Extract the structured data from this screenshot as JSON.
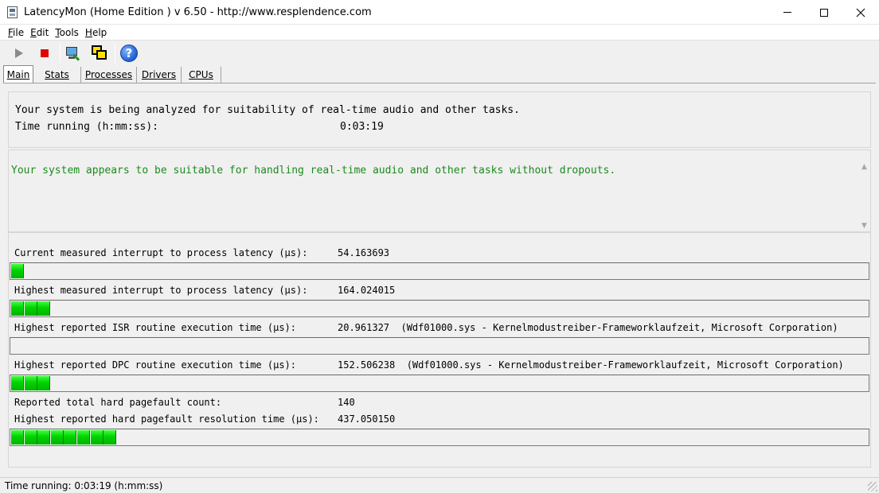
{
  "window": {
    "title": "LatencyMon  (Home Edition )  v 6.50 - http://www.resplendence.com"
  },
  "menu": {
    "items": [
      {
        "key": "F",
        "rest": "ile"
      },
      {
        "key": "E",
        "rest": "dit"
      },
      {
        "key": "T",
        "rest": "ools"
      },
      {
        "key": "H",
        "rest": "elp"
      }
    ]
  },
  "toolbar": {
    "icons": [
      "play-icon",
      "stop-icon",
      "kernel-monitor-icon",
      "windows-icon",
      "help-icon"
    ]
  },
  "tabs": [
    {
      "label": "Main",
      "active": true
    },
    {
      "label": "Stats",
      "active": false
    },
    {
      "label": "Processes",
      "active": false
    },
    {
      "label": "Drivers",
      "active": false
    },
    {
      "label": "CPUs",
      "active": false
    }
  ],
  "analysis": {
    "line1": "Your system is being analyzed for suitability of real-time audio and other tasks.",
    "time_label": "Time running (h:mm:ss):",
    "time_value": "0:03:19"
  },
  "verdict": {
    "text": "Your system appears to be suitable for handling real-time audio and other tasks without dropouts.",
    "color": "#1a8c1a"
  },
  "metrics": {
    "current_latency": {
      "label": "Current measured interrupt to process latency (µs):",
      "value": "54.163693",
      "meter_segments": 1
    },
    "highest_latency": {
      "label": "Highest measured interrupt to process latency (µs):",
      "value": "164.024015",
      "meter_segments": 3
    },
    "isr": {
      "label": "Highest reported ISR routine execution time (µs):",
      "value": "20.961327  (Wdf01000.sys - Kernelmodustreiber-Frameworklaufzeit, Microsoft Corporation)",
      "meter_segments": 0
    },
    "dpc": {
      "label": "Highest reported DPC routine execution time (µs):",
      "value": "152.506238  (Wdf01000.sys - Kernelmodustreiber-Frameworklaufzeit, Microsoft Corporation)",
      "meter_segments": 3
    },
    "pagefault_count": {
      "label": "Reported total hard pagefault count:",
      "value": "140"
    },
    "pagefault_time": {
      "label": "Highest reported hard pagefault resolution time (µs):",
      "value": "437.050150",
      "meter_segments": 8
    }
  },
  "status": {
    "text": "Time running: 0:03:19  (h:mm:ss)"
  }
}
